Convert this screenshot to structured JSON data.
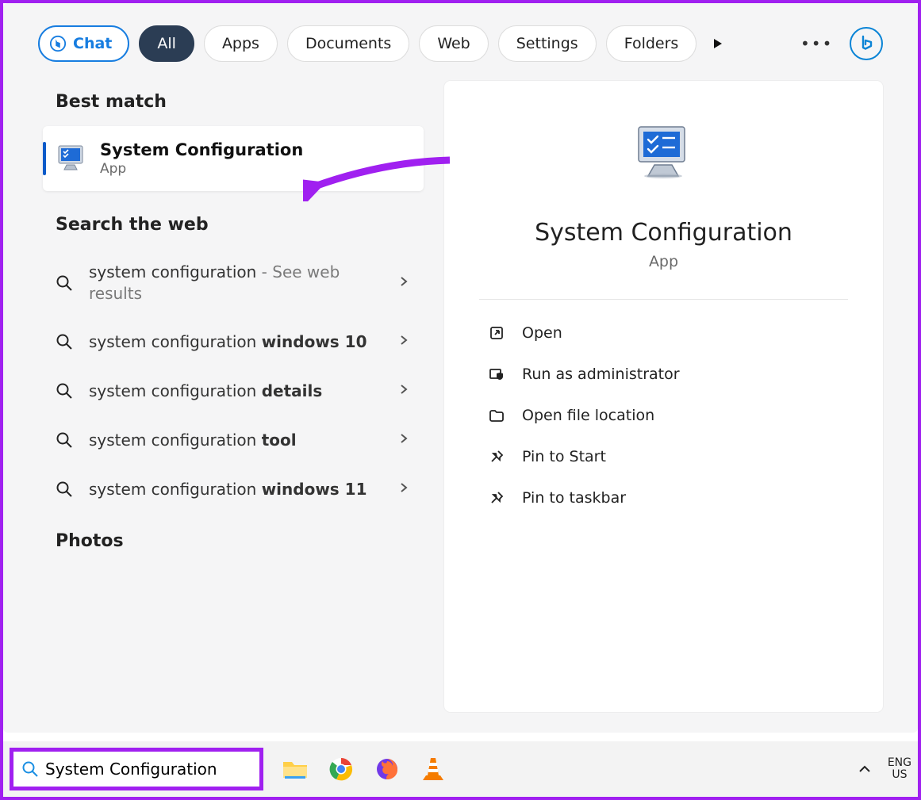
{
  "filters": {
    "chat": "Chat",
    "all": "All",
    "apps": "Apps",
    "documents": "Documents",
    "web": "Web",
    "settings": "Settings",
    "folders": "Folders"
  },
  "sections": {
    "best_match": "Best match",
    "search_web": "Search the web",
    "photos": "Photos"
  },
  "best_match": {
    "title": "System Configuration",
    "subtitle": "App"
  },
  "web_results": [
    {
      "prefix": "system configuration",
      "suffix": " - See web results",
      "bold": ""
    },
    {
      "prefix": "system configuration ",
      "suffix": "",
      "bold": "windows 10"
    },
    {
      "prefix": "system configuration ",
      "suffix": "",
      "bold": "details"
    },
    {
      "prefix": "system configuration ",
      "suffix": "",
      "bold": "tool"
    },
    {
      "prefix": "system configuration ",
      "suffix": "",
      "bold": "windows 11"
    }
  ],
  "detail": {
    "title": "System Configuration",
    "subtitle": "App",
    "actions": {
      "open": "Open",
      "run_admin": "Run as administrator",
      "open_loc": "Open file location",
      "pin_start": "Pin to Start",
      "pin_taskbar": "Pin to taskbar"
    }
  },
  "taskbar": {
    "search_value": "System Configuration",
    "lang1": "ENG",
    "lang2": "US"
  }
}
